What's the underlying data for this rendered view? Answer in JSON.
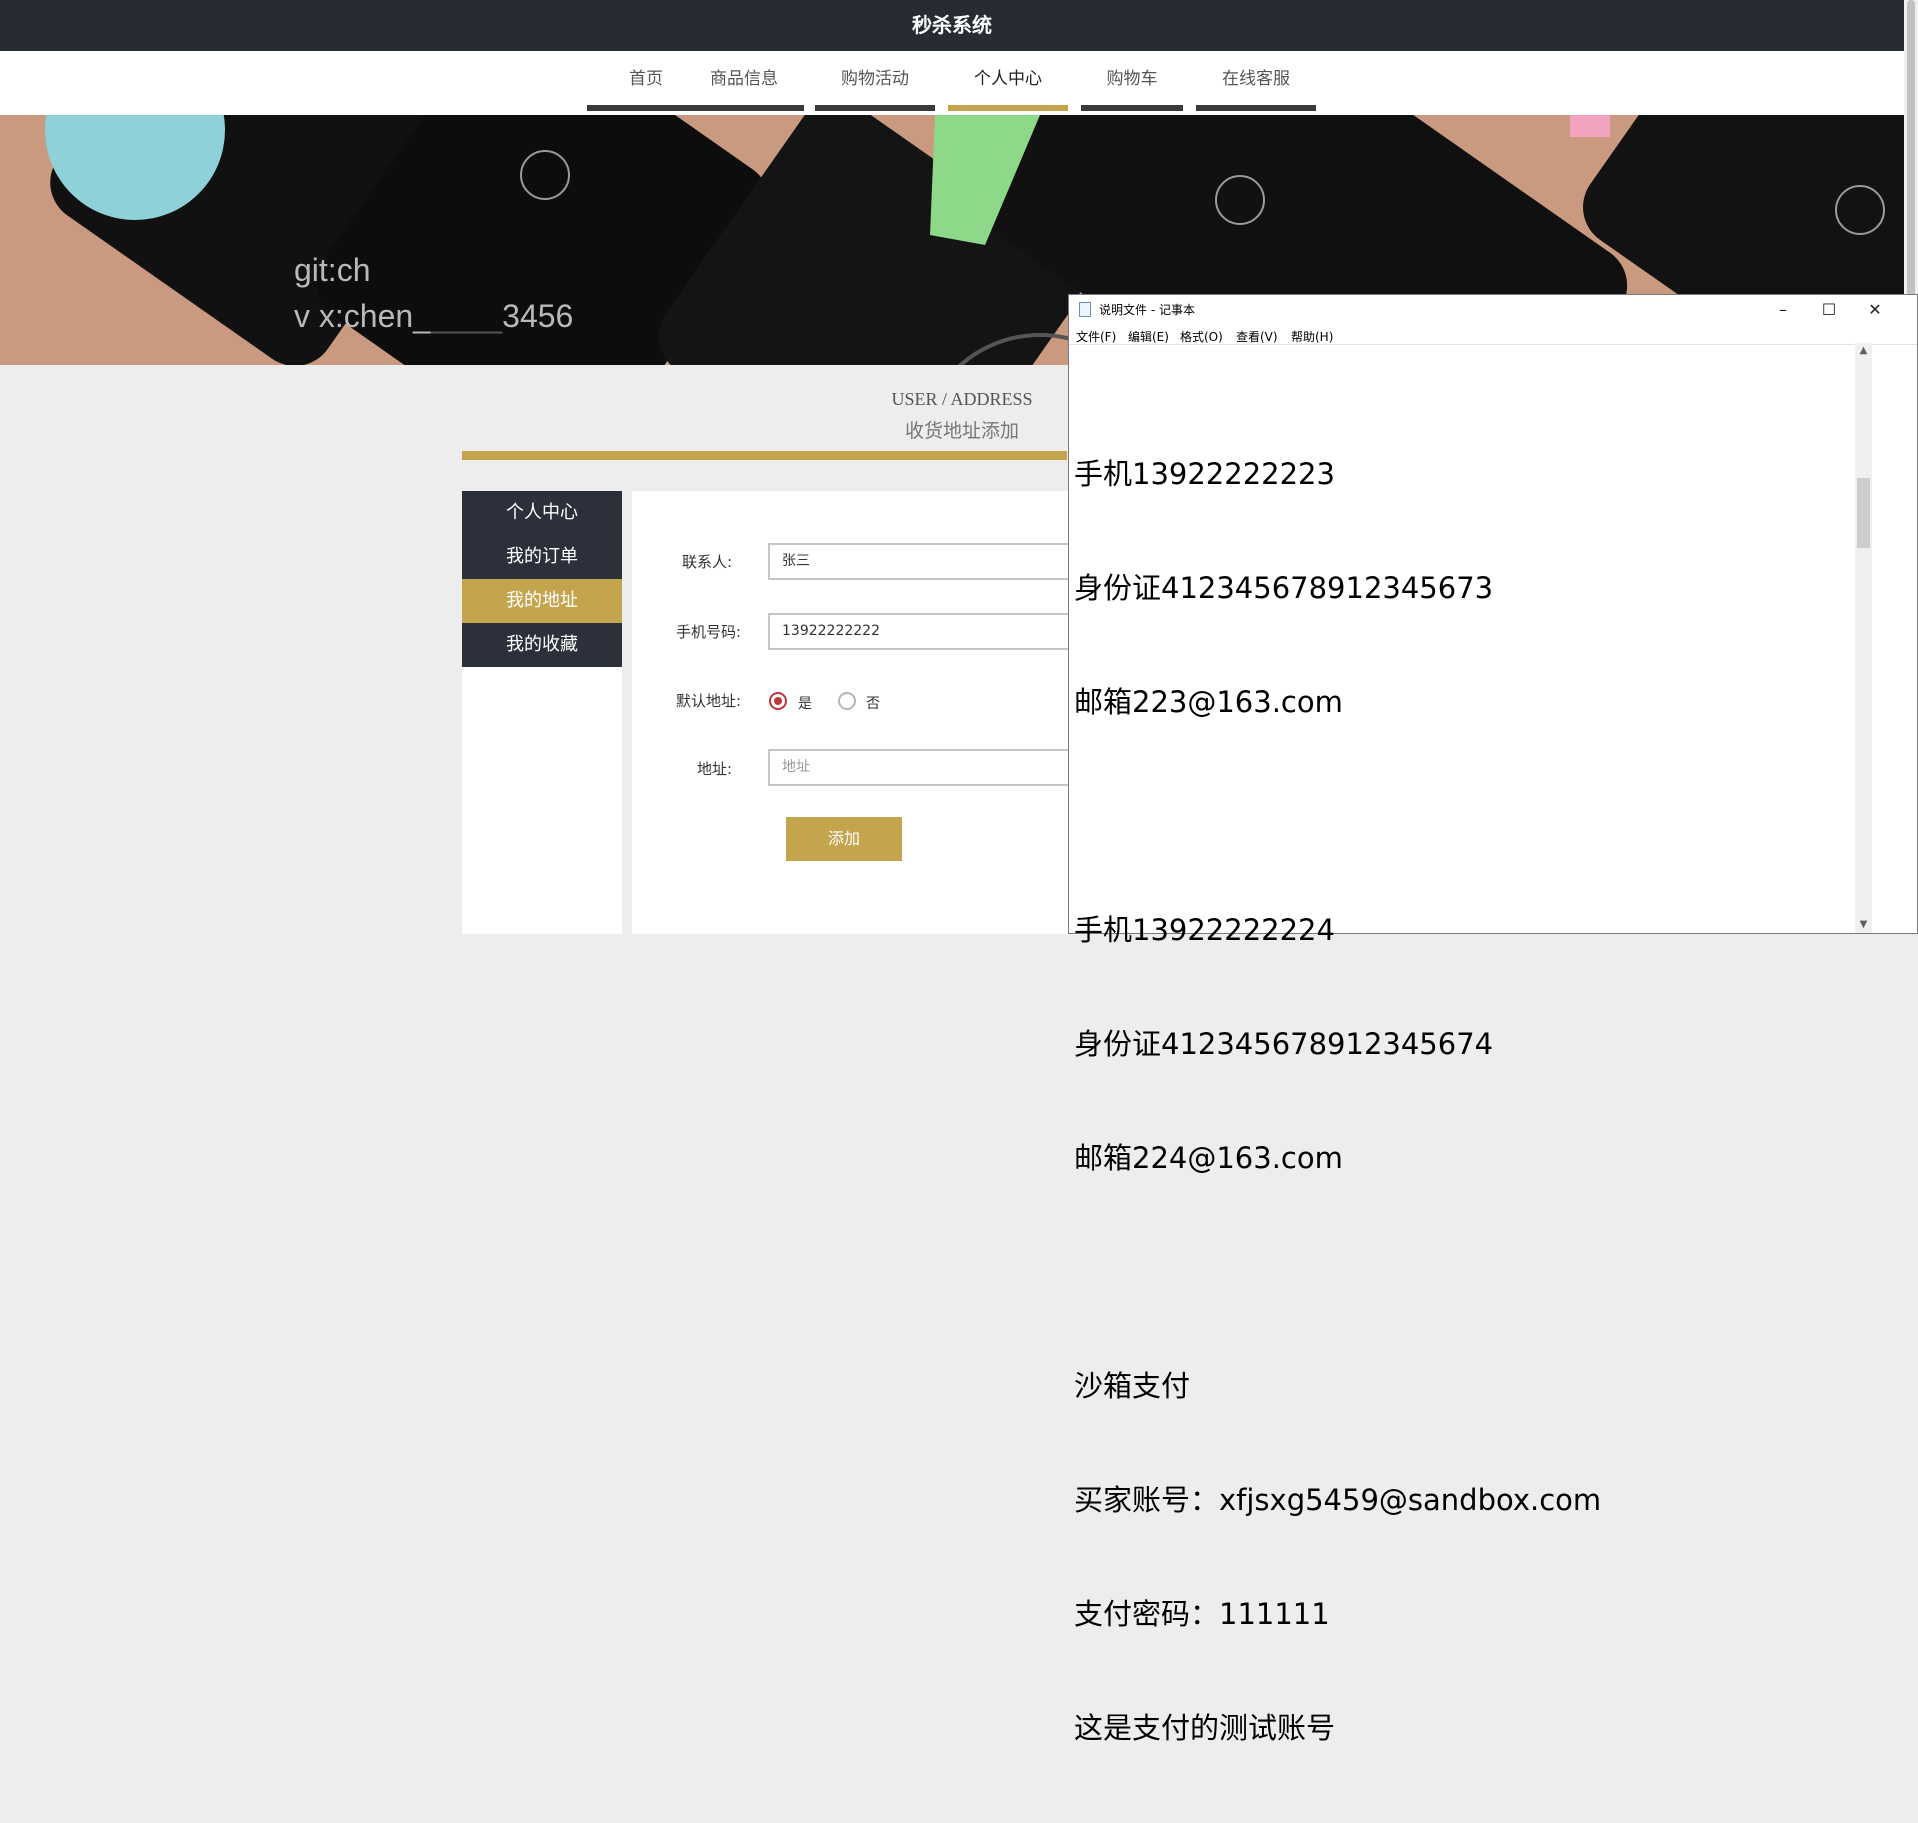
{
  "site": {
    "title": "秒杀系统"
  },
  "nav": [
    "首页",
    "商品信息",
    "购物活动",
    "个人中心",
    "购物车",
    "在线客服"
  ],
  "banner": {
    "line1": "git:ch",
    "line2": "v x:chen_",
    "line2_tail": "3456"
  },
  "section": {
    "title_en": "USER / ADDRESS",
    "title_cn": "收货地址添加"
  },
  "sidebar": [
    "个人中心",
    "我的订单",
    "我的地址",
    "我的收藏"
  ],
  "form": {
    "contact_label": "联系人:",
    "contact_value": "张三",
    "phone_label": "手机号码:",
    "phone_value": "13922222222",
    "default_label": "默认地址:",
    "default_yes": "是",
    "default_no": "否",
    "address_label": "地址:",
    "address_placeholder": "地址",
    "submit": "添加"
  },
  "notepad": {
    "title": "说明文件 - 记事本",
    "menu": [
      "文件(F)",
      "编辑(E)",
      "格式(O)",
      "查看(V)",
      "帮助(H)"
    ],
    "lines": [
      "手机13922222223",
      "身份证412345678912345673",
      "邮箱223@163.com",
      "",
      "手机13922222224",
      "身份证412345678912345674",
      "邮箱224@163.com",
      "",
      "沙箱支付",
      "买家账号：xfjsxg5459@sandbox.com",
      "支付密码：111111",
      "这是支付的测试账号"
    ]
  },
  "colors": {
    "dark": "#272c34",
    "gold": "#c5a44e",
    "radio_red": "#c0343b"
  }
}
